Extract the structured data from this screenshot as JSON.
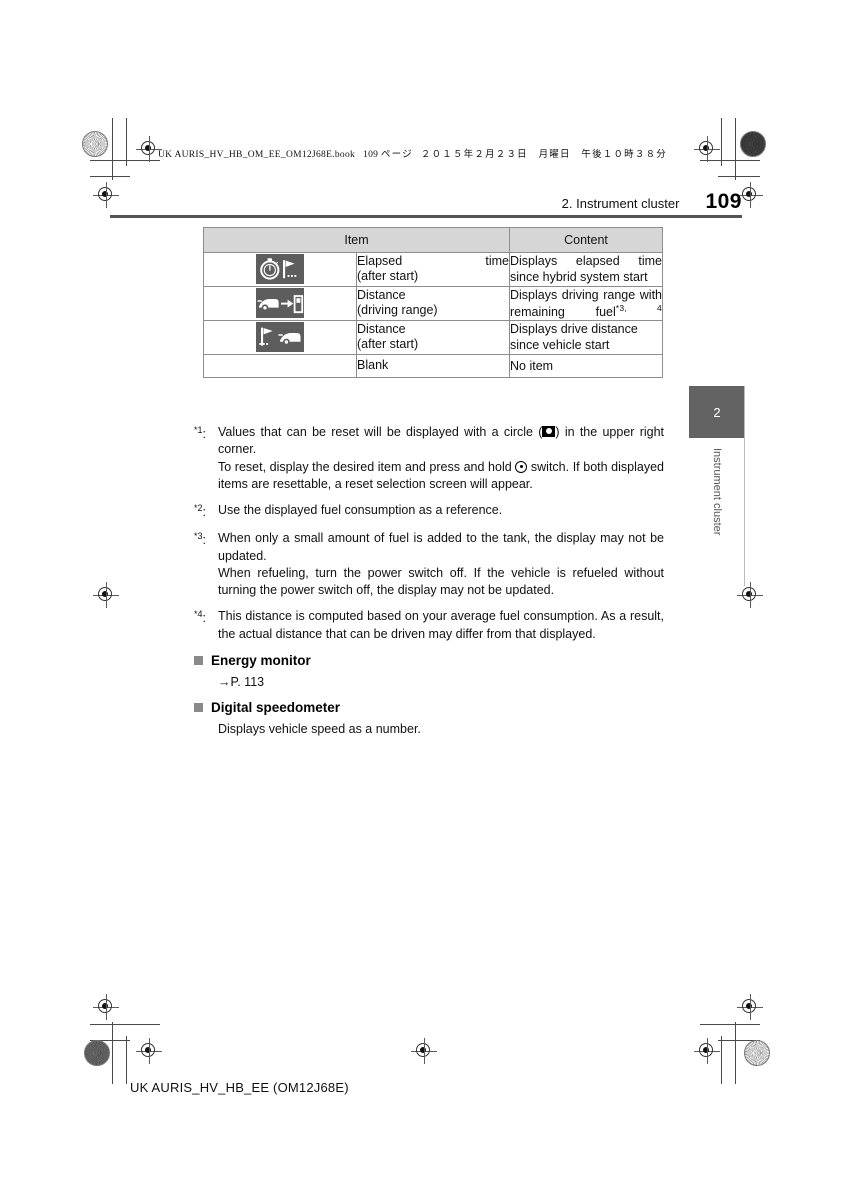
{
  "header": {
    "file_stamp": "UK AURIS_HV_HB_OM_EE_OM12J68E.book",
    "stamp_page": "109",
    "stamp_page_word": "ページ",
    "stamp_date": "２０１５年２月２３日　月曜日　午後１０時３８分",
    "chapter_title": "2. Instrument cluster",
    "page_number": "109"
  },
  "thumb_tab": {
    "number": "2",
    "label": "Instrument cluster"
  },
  "table": {
    "columns": [
      "Item",
      "Content"
    ],
    "rows": [
      {
        "icon": "stopwatch-flag-icon",
        "item_line1": "Elapsed          time",
        "item_line2": "(after start)",
        "content": "Displays elapsed time since hybrid system start",
        "content_footnotes": ""
      },
      {
        "icon": "car-to-fuel-pump-icon",
        "item_line1": "Distance",
        "item_line2": "(driving range)",
        "content": "Displays driving range with remaining fuel",
        "content_footnotes": "*3, 4"
      },
      {
        "icon": "flag-to-car-icon",
        "item_line1": "Distance",
        "item_line2": "(after start)",
        "content": "Displays drive distance since vehicle start",
        "content_footnotes": ""
      },
      {
        "icon": "",
        "item_line1": "Blank",
        "item_line2": "",
        "content": "No item",
        "content_footnotes": ""
      }
    ]
  },
  "footnotes": [
    {
      "mark": "*1",
      "mark_suffix": ":",
      "paragraphs": [
        "Values that can be reset will be displayed with a circle (SQUARE_ICON) in the upper right corner.",
        "To reset, display the desired item and press and hold CIRCLE_ICON switch. If both displayed items are resettable, a reset selection screen will appear."
      ],
      "part_a": "Values that can be reset will be displayed with a circle (",
      "part_b": ") in the upper right corner.",
      "part_c": "To reset, display the desired item and press and hold ",
      "part_d": " switch. If both displayed items are resettable, a reset selection screen will appear."
    },
    {
      "mark": "*2",
      "mark_suffix": ":",
      "text": "Use the displayed fuel consumption as a reference."
    },
    {
      "mark": "*3",
      "mark_suffix": ":",
      "line1": "When only a small amount of fuel is added to the tank, the display may not be updated.",
      "line2": "When refueling, turn the power switch off. If the vehicle is refueled without turning the power switch off, the display may not be updated."
    },
    {
      "mark": "*4",
      "mark_suffix": ":",
      "text": "This distance is computed based on your average fuel consumption. As a result, the actual distance that can be driven may differ from that displayed."
    }
  ],
  "sections": [
    {
      "heading": "Energy monitor",
      "body": "→P. 113"
    },
    {
      "heading": "Digital speedometer",
      "body": "Displays vehicle speed as a number."
    }
  ],
  "footer": {
    "doc_code": "UK AURIS_HV_HB_EE (OM12J68E)"
  },
  "colors": {
    "table_header_bg": "#d6d6d6",
    "icon_tile_bg": "#5d5d5d",
    "thumb_tab_bg": "#636363",
    "rule": "#555555"
  }
}
